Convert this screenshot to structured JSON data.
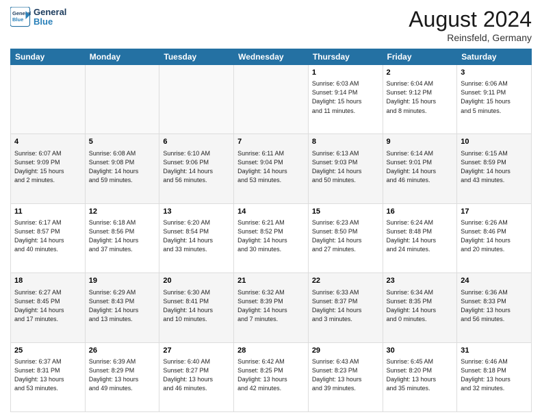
{
  "header": {
    "logo_line1": "General",
    "logo_line2": "Blue",
    "month_title": "August 2024",
    "location": "Reinsfeld, Germany"
  },
  "days_of_week": [
    "Sunday",
    "Monday",
    "Tuesday",
    "Wednesday",
    "Thursday",
    "Friday",
    "Saturday"
  ],
  "weeks": [
    [
      {
        "day": "",
        "info": ""
      },
      {
        "day": "",
        "info": ""
      },
      {
        "day": "",
        "info": ""
      },
      {
        "day": "",
        "info": ""
      },
      {
        "day": "1",
        "info": "Sunrise: 6:03 AM\nSunset: 9:14 PM\nDaylight: 15 hours\nand 11 minutes."
      },
      {
        "day": "2",
        "info": "Sunrise: 6:04 AM\nSunset: 9:12 PM\nDaylight: 15 hours\nand 8 minutes."
      },
      {
        "day": "3",
        "info": "Sunrise: 6:06 AM\nSunset: 9:11 PM\nDaylight: 15 hours\nand 5 minutes."
      }
    ],
    [
      {
        "day": "4",
        "info": "Sunrise: 6:07 AM\nSunset: 9:09 PM\nDaylight: 15 hours\nand 2 minutes."
      },
      {
        "day": "5",
        "info": "Sunrise: 6:08 AM\nSunset: 9:08 PM\nDaylight: 14 hours\nand 59 minutes."
      },
      {
        "day": "6",
        "info": "Sunrise: 6:10 AM\nSunset: 9:06 PM\nDaylight: 14 hours\nand 56 minutes."
      },
      {
        "day": "7",
        "info": "Sunrise: 6:11 AM\nSunset: 9:04 PM\nDaylight: 14 hours\nand 53 minutes."
      },
      {
        "day": "8",
        "info": "Sunrise: 6:13 AM\nSunset: 9:03 PM\nDaylight: 14 hours\nand 50 minutes."
      },
      {
        "day": "9",
        "info": "Sunrise: 6:14 AM\nSunset: 9:01 PM\nDaylight: 14 hours\nand 46 minutes."
      },
      {
        "day": "10",
        "info": "Sunrise: 6:15 AM\nSunset: 8:59 PM\nDaylight: 14 hours\nand 43 minutes."
      }
    ],
    [
      {
        "day": "11",
        "info": "Sunrise: 6:17 AM\nSunset: 8:57 PM\nDaylight: 14 hours\nand 40 minutes."
      },
      {
        "day": "12",
        "info": "Sunrise: 6:18 AM\nSunset: 8:56 PM\nDaylight: 14 hours\nand 37 minutes."
      },
      {
        "day": "13",
        "info": "Sunrise: 6:20 AM\nSunset: 8:54 PM\nDaylight: 14 hours\nand 33 minutes."
      },
      {
        "day": "14",
        "info": "Sunrise: 6:21 AM\nSunset: 8:52 PM\nDaylight: 14 hours\nand 30 minutes."
      },
      {
        "day": "15",
        "info": "Sunrise: 6:23 AM\nSunset: 8:50 PM\nDaylight: 14 hours\nand 27 minutes."
      },
      {
        "day": "16",
        "info": "Sunrise: 6:24 AM\nSunset: 8:48 PM\nDaylight: 14 hours\nand 24 minutes."
      },
      {
        "day": "17",
        "info": "Sunrise: 6:26 AM\nSunset: 8:46 PM\nDaylight: 14 hours\nand 20 minutes."
      }
    ],
    [
      {
        "day": "18",
        "info": "Sunrise: 6:27 AM\nSunset: 8:45 PM\nDaylight: 14 hours\nand 17 minutes."
      },
      {
        "day": "19",
        "info": "Sunrise: 6:29 AM\nSunset: 8:43 PM\nDaylight: 14 hours\nand 13 minutes."
      },
      {
        "day": "20",
        "info": "Sunrise: 6:30 AM\nSunset: 8:41 PM\nDaylight: 14 hours\nand 10 minutes."
      },
      {
        "day": "21",
        "info": "Sunrise: 6:32 AM\nSunset: 8:39 PM\nDaylight: 14 hours\nand 7 minutes."
      },
      {
        "day": "22",
        "info": "Sunrise: 6:33 AM\nSunset: 8:37 PM\nDaylight: 14 hours\nand 3 minutes."
      },
      {
        "day": "23",
        "info": "Sunrise: 6:34 AM\nSunset: 8:35 PM\nDaylight: 14 hours\nand 0 minutes."
      },
      {
        "day": "24",
        "info": "Sunrise: 6:36 AM\nSunset: 8:33 PM\nDaylight: 13 hours\nand 56 minutes."
      }
    ],
    [
      {
        "day": "25",
        "info": "Sunrise: 6:37 AM\nSunset: 8:31 PM\nDaylight: 13 hours\nand 53 minutes."
      },
      {
        "day": "26",
        "info": "Sunrise: 6:39 AM\nSunset: 8:29 PM\nDaylight: 13 hours\nand 49 minutes."
      },
      {
        "day": "27",
        "info": "Sunrise: 6:40 AM\nSunset: 8:27 PM\nDaylight: 13 hours\nand 46 minutes."
      },
      {
        "day": "28",
        "info": "Sunrise: 6:42 AM\nSunset: 8:25 PM\nDaylight: 13 hours\nand 42 minutes."
      },
      {
        "day": "29",
        "info": "Sunrise: 6:43 AM\nSunset: 8:23 PM\nDaylight: 13 hours\nand 39 minutes."
      },
      {
        "day": "30",
        "info": "Sunrise: 6:45 AM\nSunset: 8:20 PM\nDaylight: 13 hours\nand 35 minutes."
      },
      {
        "day": "31",
        "info": "Sunrise: 6:46 AM\nSunset: 8:18 PM\nDaylight: 13 hours\nand 32 minutes."
      }
    ]
  ]
}
